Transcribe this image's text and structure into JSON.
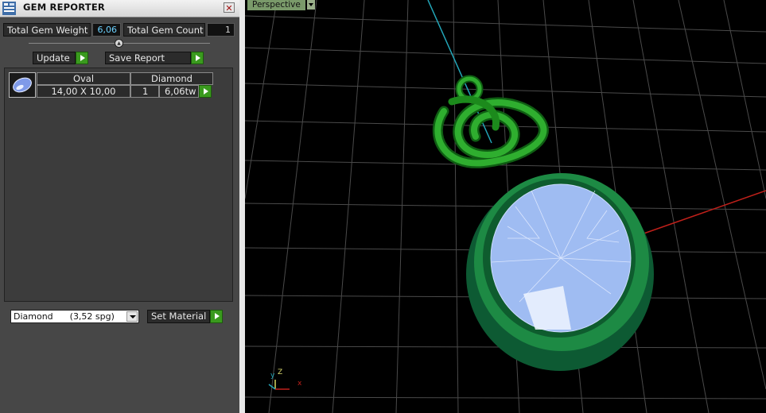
{
  "window": {
    "title": "GEM REPORTER",
    "close_glyph": "✕"
  },
  "summary": {
    "weight_label": "Total Gem Weight",
    "weight_value": "6,06",
    "count_label": "Total Gem Count",
    "count_value": "1"
  },
  "actions": {
    "update_label": "Update",
    "save_report_label": "Save Report"
  },
  "gem_table": {
    "rows": [
      {
        "icon": "oval-gem-icon",
        "shape": "Oval",
        "material": "Diamond",
        "size": "14,00 X 10,00",
        "count": "1",
        "weight": "6,06tw"
      }
    ]
  },
  "material": {
    "selected": "Diamond      (3,52 spg)",
    "set_label": "Set Material"
  },
  "viewport": {
    "label": "Perspective",
    "axis_z": "Z",
    "axis_y": "y",
    "axis_x": "x"
  },
  "colors": {
    "accent_green": "#3a9a1e",
    "gem_blue": "#a9c4f5",
    "metal_green": "#1f8a3a",
    "grid": "#555555"
  }
}
